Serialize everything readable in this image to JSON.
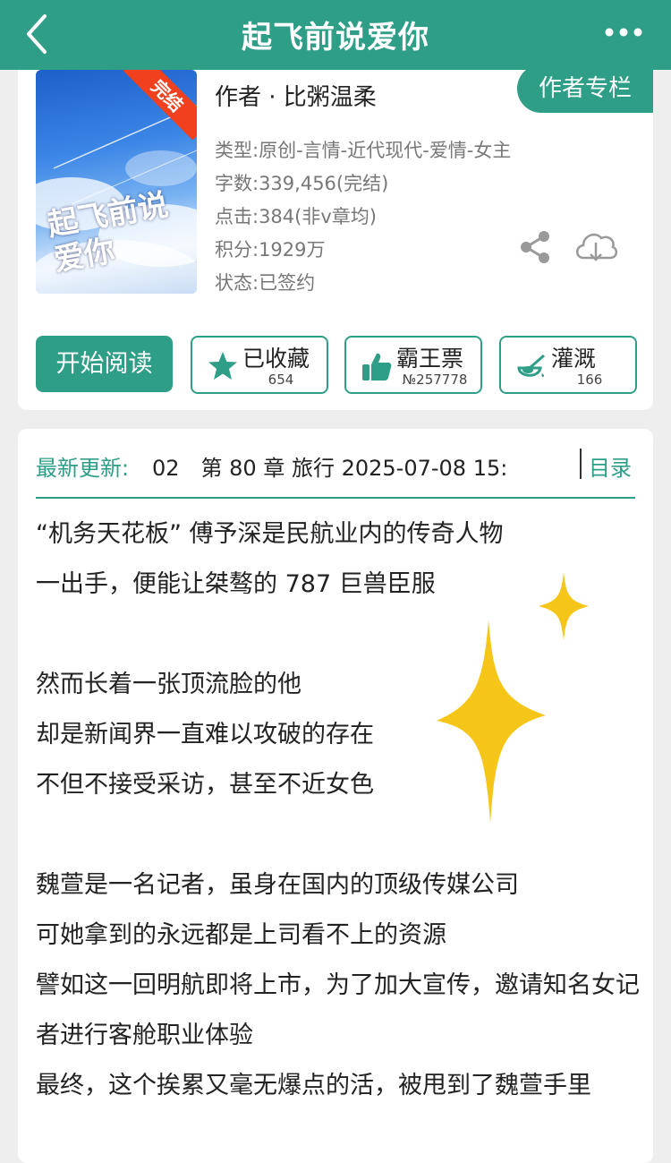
{
  "header": {
    "title": "起飞前说爱你"
  },
  "book": {
    "cover_title": "起飞前说爱你",
    "ribbon": "完结",
    "author": "作者 · 比粥温柔",
    "author_column": "作者专栏",
    "meta": {
      "type": "类型:原创-言情-近代现代-爱情-女主",
      "words": "字数:339,456(完结)",
      "clicks": "点击:384(非v章均)",
      "points": "积分:1929万",
      "status": "状态:已签约"
    }
  },
  "actions": {
    "start": "开始阅读",
    "favorite": {
      "label": "已收藏",
      "count": "654"
    },
    "ticket": {
      "label": "霸王票",
      "count": "№257778"
    },
    "water": {
      "label": "灌溉",
      "count": "166"
    }
  },
  "update": {
    "label": "最新更新:",
    "text": "02　第 80 章 旅行 2025-07-08 15:",
    "toc": "目录"
  },
  "intro": [
    "“机务天花板” 傅予深是民航业内的传奇人物",
    "一出手，便能让桀骜的 787 巨兽臣服",
    "",
    "然而长着一张顶流脸的他",
    "却是新闻界一直难以攻破的存在",
    "不但不接受采访，甚至不近女色",
    "",
    "魏萱是一名记者，虽身在国内的顶级传媒公司",
    "可她拿到的永远都是上司看不上的资源",
    "譬如这一回明航即将上市，为了加大宣传，邀请知名女记者进行客舱职业体验",
    "最终，这个挨累又毫无爆点的活，被甩到了魏萱手里"
  ],
  "colors": {
    "accent": "#2f9e87",
    "ribbon": "#f0401e",
    "sparkle": "#f5c518"
  }
}
